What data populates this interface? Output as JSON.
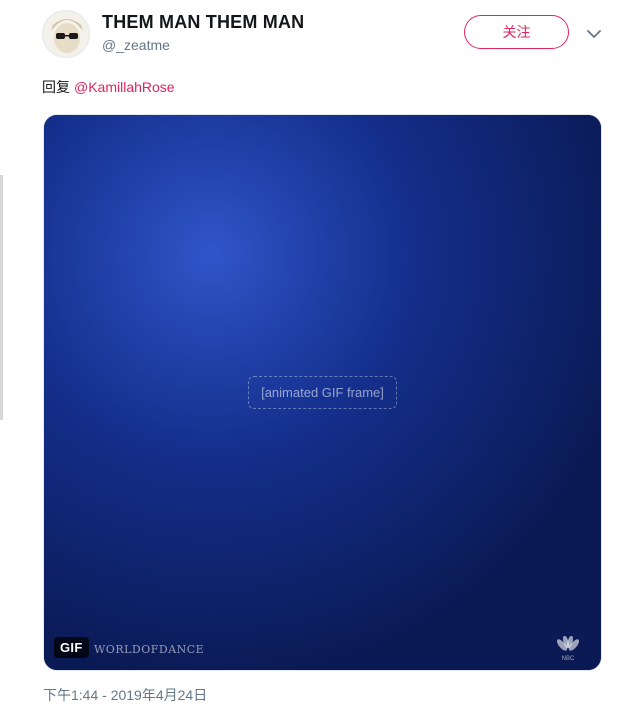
{
  "user": {
    "name": "THEM MAN THEM MAN",
    "handle": "@_zeatme"
  },
  "follow_button": {
    "label": "关注",
    "color": "#e0245e"
  },
  "menu": {
    "icon": "chevron-down-icon"
  },
  "reply": {
    "label": "回复",
    "mention": "@KamillahRose",
    "mention_color": "#e0245e"
  },
  "media": {
    "badge": "GIF",
    "watermark": "WORLDOFDANCE",
    "network_logo": "nbc-peacock-icon"
  },
  "timestamp": "下午1:44 - 2019年4月24日"
}
